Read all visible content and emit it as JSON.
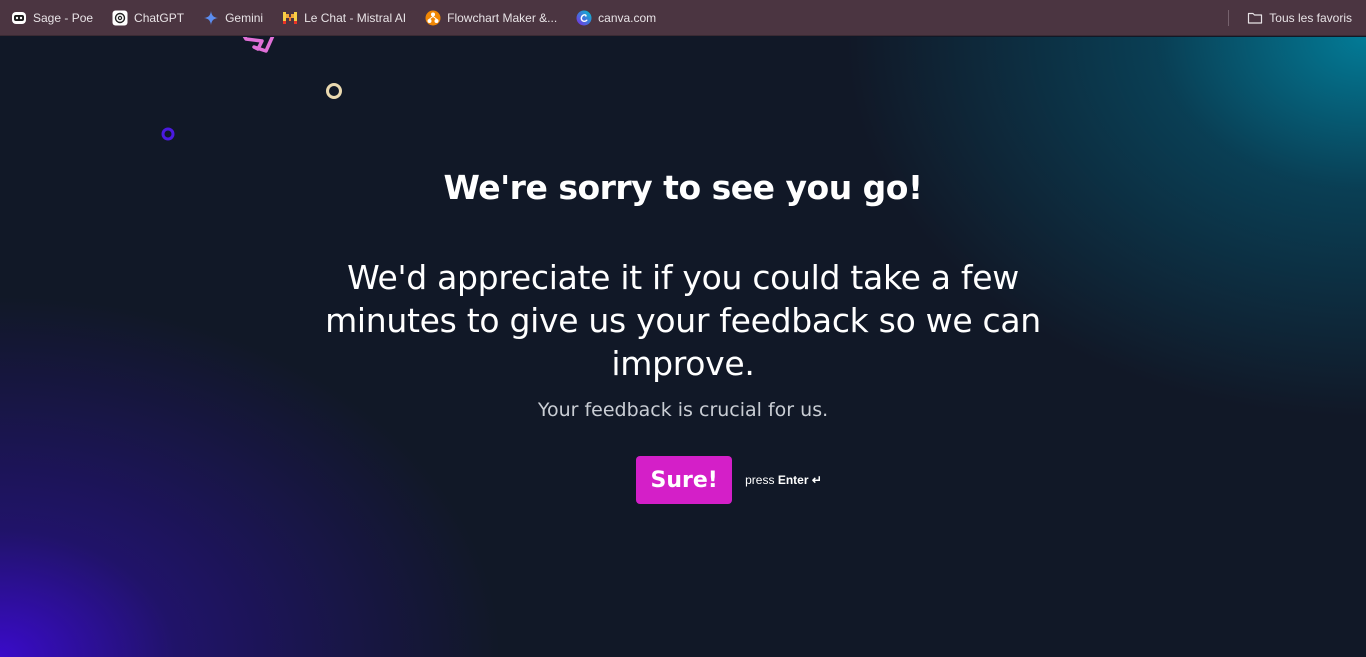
{
  "bookmarks": [
    {
      "label": "Sage - Poe",
      "icon": "poe-icon"
    },
    {
      "label": "ChatGPT",
      "icon": "chatgpt-icon"
    },
    {
      "label": "Gemini",
      "icon": "gemini-icon"
    },
    {
      "label": "Le Chat - Mistral AI",
      "icon": "mistral-icon"
    },
    {
      "label": "Flowchart Maker &...",
      "icon": "flowchart-icon"
    },
    {
      "label": "canva.com",
      "icon": "canva-icon"
    }
  ],
  "all_bookmarks_label": "Tous les favoris",
  "page": {
    "title": "We're sorry to see you go!",
    "lead": "We'd appreciate it if you could take a few minutes to give us your feedback so we can improve.",
    "sub": "Your feedback is crucial for us.",
    "button_label": "Sure!",
    "hint_prefix": "press",
    "hint_key": "Enter ↵"
  },
  "colors": {
    "accent": "#d41fc8",
    "background": "#111827",
    "bookmarks_bar": "#4b3541"
  }
}
